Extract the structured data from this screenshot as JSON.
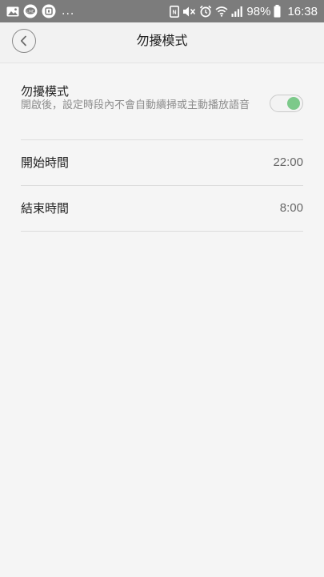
{
  "status_bar": {
    "more_indicator": "...",
    "notification_icons": [
      "gallery-icon",
      "line-app-icon",
      "mi-app-icon"
    ],
    "system_icons": [
      "nfc-icon",
      "mute-icon",
      "alarm-icon",
      "wifi-icon",
      "signal-icon",
      "battery-icon"
    ],
    "line_badge": "LINE",
    "battery_percent": "98%",
    "time": "16:38"
  },
  "header": {
    "back_icon": "chevron-left-icon",
    "title": "勿擾模式"
  },
  "settings": {
    "dnd": {
      "title": "勿擾模式",
      "description": "開啟後，設定時段內不會自動續掃或主動播放語音",
      "enabled": true,
      "toggle_color": "#7cc98a"
    },
    "start_time": {
      "label": "開始時間",
      "value": "22:00"
    },
    "end_time": {
      "label": "結束時間",
      "value": "8:00"
    }
  }
}
